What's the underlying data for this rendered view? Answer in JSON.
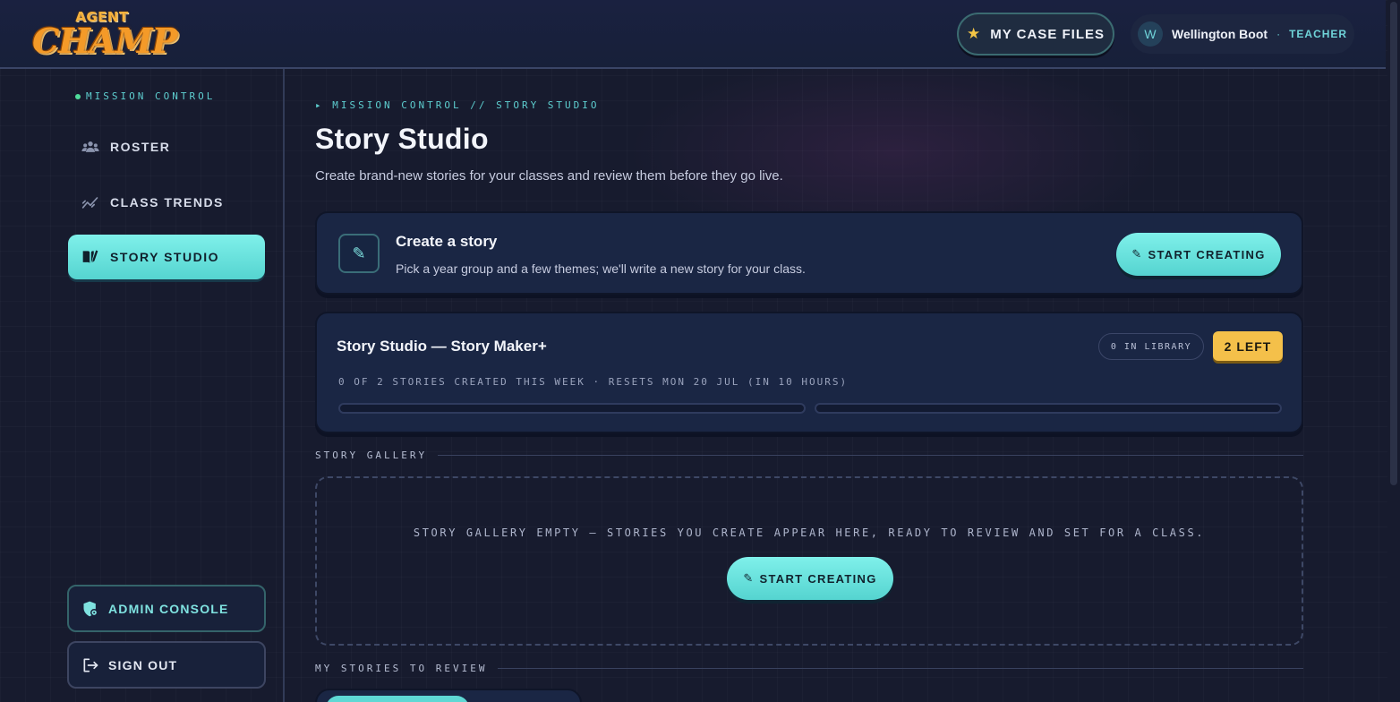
{
  "brand": {
    "logo_top": "AGENT",
    "logo_main": "CHAMP"
  },
  "header": {
    "case_files_label": "MY CASE FILES",
    "user": {
      "initial": "W",
      "name": "Wellington Boot",
      "separator": "·",
      "role": "TEACHER"
    }
  },
  "sidebar": {
    "heading": "MISSION CONTROL",
    "items": [
      {
        "label": "ROSTER",
        "icon": "users-icon",
        "active": false
      },
      {
        "label": "CLASS TRENDS",
        "icon": "trend-line-icon",
        "active": false
      },
      {
        "label": "STORY STUDIO",
        "icon": "book-pen-icon",
        "active": true
      }
    ],
    "admin_label": "ADMIN CONSOLE",
    "signout_label": "SIGN OUT"
  },
  "main": {
    "breadcrumb": "▸ MISSION CONTROL // STORY STUDIO",
    "title": "Story Studio",
    "subtitle": "Create brand-new stories for your classes and review them before they go live.",
    "create": {
      "title": "Create a story",
      "description": "Pick a year group and a few themes; we'll write a new story for your class.",
      "button": "START CREATING",
      "icon_glyph": "✎"
    },
    "maker": {
      "title": "Story Studio — Story Maker+",
      "library_pill": "0 IN LIBRARY",
      "left_pill": "2 LEFT",
      "meta": "0 OF 2 STORIES CREATED THIS WEEK · RESETS MON 20 JUL (IN 10 HOURS)",
      "slots_used": 0,
      "slots_total": 2
    },
    "gallery": {
      "label": "STORY GALLERY",
      "empty_text": "STORY GALLERY EMPTY — STORIES YOU CREATE APPEAR HERE, READY TO REVIEW AND SET FOR A CLASS.",
      "button": "START CREATING"
    },
    "review": {
      "label": "MY STORIES TO REVIEW"
    }
  },
  "colors": {
    "accent": "#5fd8d4",
    "badge": "#f4c04a",
    "bg": "#171b2e",
    "card": "#1a2644"
  }
}
